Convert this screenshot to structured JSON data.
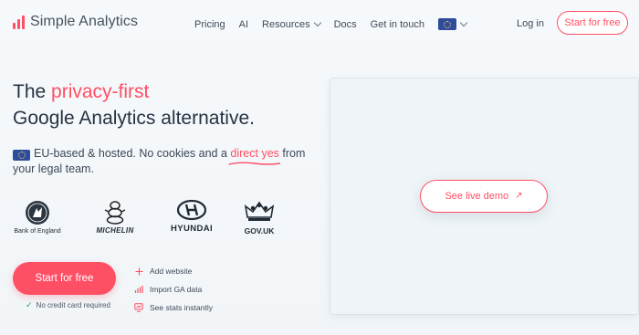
{
  "brand": {
    "name": "Simple Analytics",
    "accent": "#ff4f64"
  },
  "nav": {
    "links": [
      "Pricing",
      "AI",
      "Resources",
      "Docs",
      "Get in touch"
    ],
    "login": "Log in",
    "cta": "Start for free"
  },
  "hero": {
    "headline_prefix": "The ",
    "headline_accent": "privacy-first",
    "headline_line2": "Google Analytics alternative.",
    "sub_part1": "EU-based & hosted. No cookies and a ",
    "sub_accent": "direct yes",
    "sub_part2": " from your legal team.",
    "clients": [
      "Bank of England",
      "MICHELIN",
      "HYUNDAI",
      "GOV.UK"
    ],
    "cta": "Start for free",
    "no_cc": "No credit card required",
    "features": [
      "Add website",
      "Import GA data",
      "See stats instantly"
    ]
  },
  "demo": {
    "button": "See live demo"
  }
}
